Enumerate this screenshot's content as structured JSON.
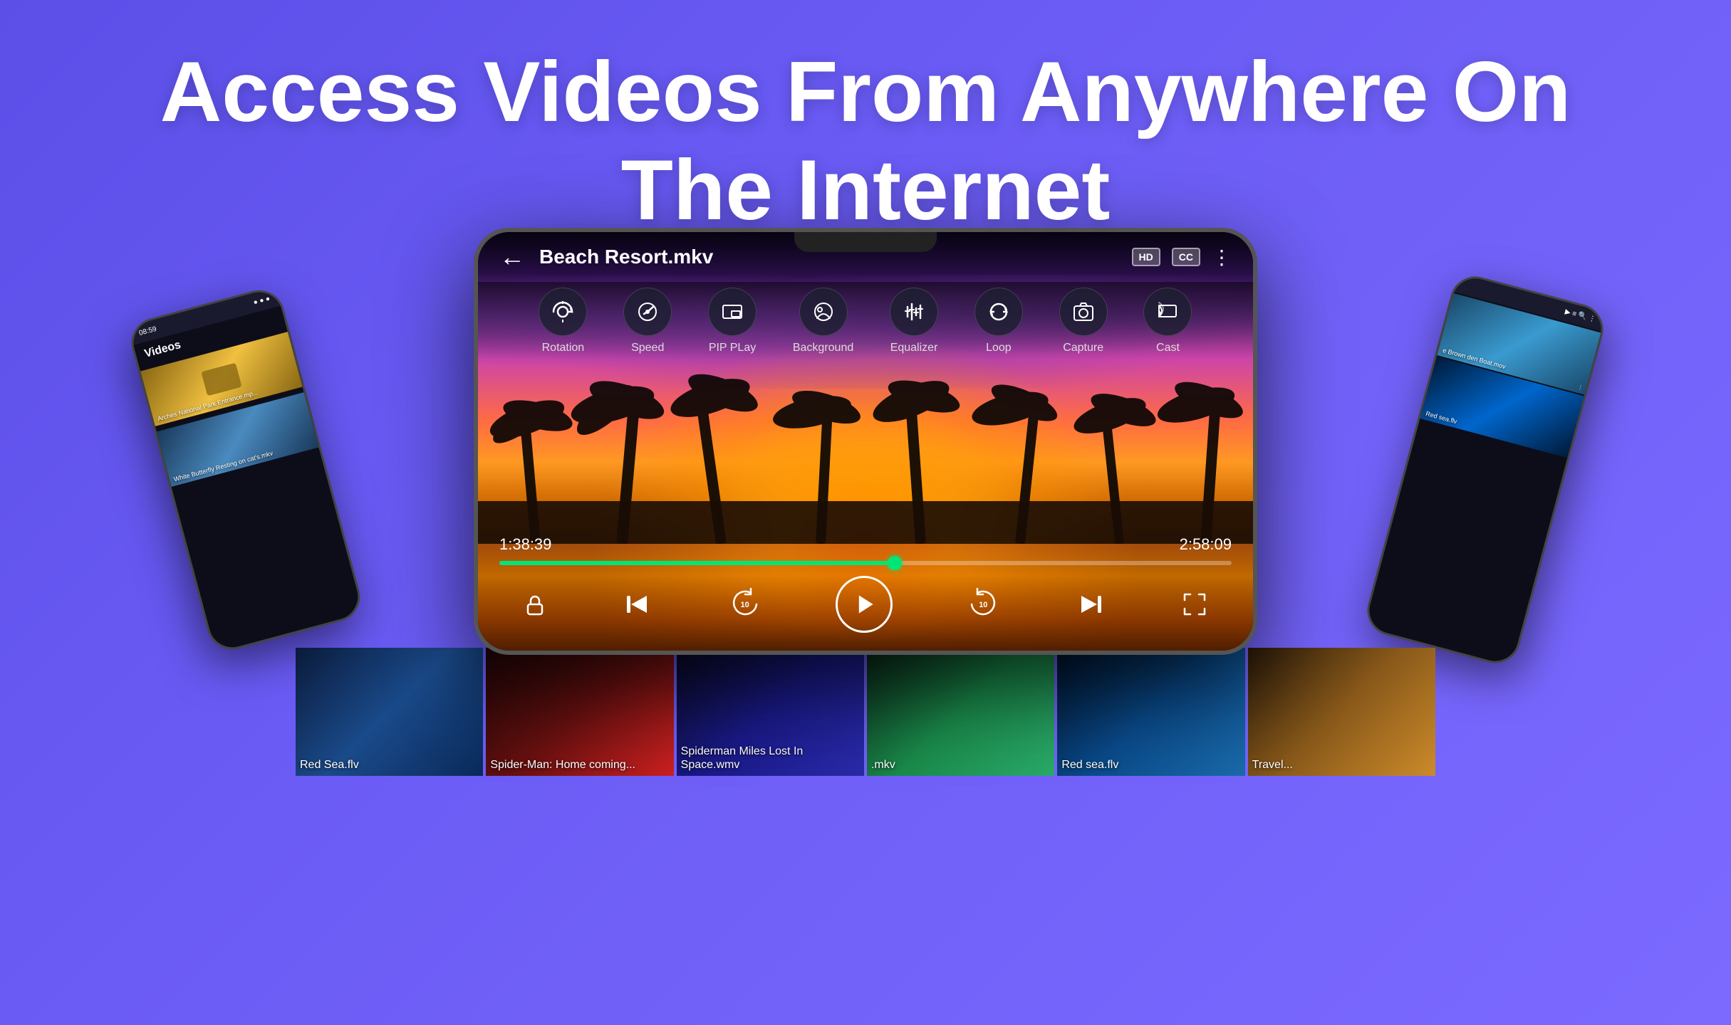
{
  "headline": {
    "line1": "Access Videos From Anywhere On",
    "line2": "The Internet"
  },
  "player": {
    "back_label": "←",
    "title": "Beach Resort.mkv",
    "badge_hd": "HD",
    "badge_cc": "CC",
    "time_current": "1:38:39",
    "time_total": "2:58:09",
    "controls": [
      {
        "id": "rotation",
        "label": "Rotation"
      },
      {
        "id": "speed",
        "label": "Speed"
      },
      {
        "id": "pip",
        "label": "PIP PLay"
      },
      {
        "id": "background",
        "label": "Background"
      },
      {
        "id": "equalizer",
        "label": "Equalizer"
      },
      {
        "id": "loop",
        "label": "Loop"
      },
      {
        "id": "capture",
        "label": "Capture"
      },
      {
        "id": "cast",
        "label": "Cast"
      }
    ]
  },
  "left_phone": {
    "time": "08:59",
    "title": "Videos",
    "items": [
      {
        "label": "Arches National Park Entrance.mp..."
      },
      {
        "label": "White Butterfly Resting on cat's.mkv"
      }
    ]
  },
  "right_phone": {
    "items": [
      {
        "label": "e Brown\nden Boat.mov"
      },
      {
        "label": "Red sea.flv"
      }
    ]
  },
  "thumbnails": [
    {
      "label": "Red Sea.flv",
      "color1": "#0a2a4a",
      "color2": "#1a6aaa"
    },
    {
      "label": "Spider-Man: Home coming...",
      "color1": "#1a0a0a",
      "color2": "#8a1a1a"
    },
    {
      "label": "Spiderman Miles Lost In Space.wmv",
      "color1": "#0a1a3a",
      "color2": "#2a4a9a"
    },
    {
      "label": ".mkv",
      "color1": "#0a2a1a",
      "color2": "#1a8a4a"
    },
    {
      "label": "Red sea.flv",
      "color1": "#001a3a",
      "color2": "#0a5aaa"
    },
    {
      "label": "Travel...",
      "color1": "#1a1a0a",
      "color2": "#6a6a1a"
    }
  ],
  "colors": {
    "bg_start": "#5b4fe8",
    "bg_end": "#7c6aff",
    "progress_color": "#00e676",
    "text_white": "#ffffff"
  }
}
